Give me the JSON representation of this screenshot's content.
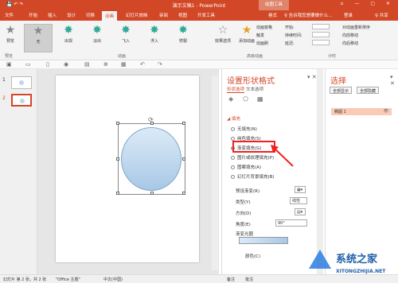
{
  "titlebar": {
    "title": "演示文稿1 - PowerPoint",
    "tools": "绘图工具"
  },
  "tabs": [
    "文件",
    "开始",
    "插入",
    "设计",
    "切换",
    "动画",
    "幻灯片放映",
    "审阅",
    "视图",
    "开发工具",
    "格式"
  ],
  "active_tab": "动画",
  "tell_me": "♀ 告诉我您想要做什么...",
  "login": "登录",
  "share": "♀ 共享",
  "ribbon": {
    "preview": "预览",
    "animations": [
      "无",
      "出现",
      "淡出",
      "飞入",
      "浮入",
      "劈裂"
    ],
    "effect_options": "效果选项",
    "add_animation": "添加动画",
    "adv_items": [
      "动画窗格",
      "触发",
      "动画刷"
    ],
    "timing_items": [
      "开始:",
      "持续时间:",
      "延迟:"
    ],
    "reorder_title": "对动画重新排序",
    "reorder_items": [
      "向前移动",
      "向后移动"
    ],
    "groups": [
      "预览",
      "动画",
      "高级动画",
      "计时"
    ]
  },
  "slides": {
    "nums": [
      "1",
      "2"
    ]
  },
  "format_pane": {
    "title": "设置形状格式",
    "sub1": "形状选项",
    "sub2": "文本选项",
    "section": "◢ 填充",
    "options": [
      "无填充(N)",
      "纯色填充(S)",
      "渐变填充(G)",
      "图片或纹理填充(P)",
      "图案填充(A)",
      "幻灯片背景填充(B)"
    ],
    "selected_option": "渐变填充(G)",
    "preset": "预设渐变(R)",
    "type_label": "类型(Y)",
    "type_value": "线性",
    "direction": "方向(D)",
    "angle_label": "角度(E)",
    "angle_value": "90°",
    "stops": "渐变光圈",
    "color": "颜色(C)"
  },
  "selection_pane": {
    "title": "选择",
    "show_all": "全部显示",
    "hide_all": "全部隐藏",
    "item": "椭圆 1"
  },
  "status": {
    "slide": "幻灯片 第 2 张，共 2 张",
    "theme": "\"Office 主题\"",
    "lang": "中文(中国)",
    "notes": "备注",
    "comments": "批注"
  },
  "watermark": {
    "title": "系统之家",
    "url": "XITONGZHIJIA.NET"
  },
  "colors": {
    "accent": "#d24726",
    "highlight": "#ee2222",
    "fill_top": "#dceaf7",
    "fill_bottom": "#a8c8e6"
  }
}
